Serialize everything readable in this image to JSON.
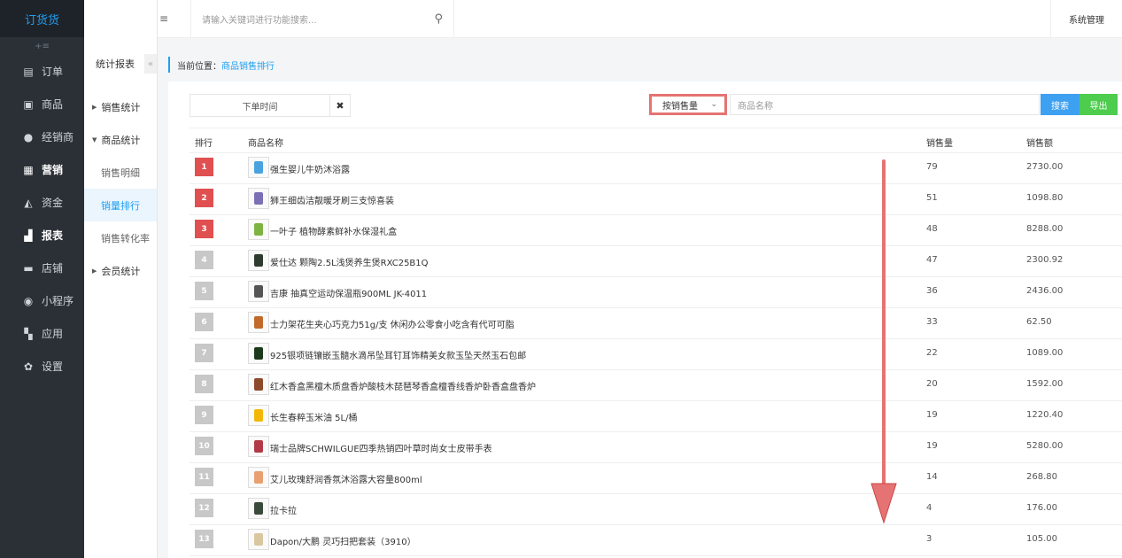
{
  "app": {
    "logo": "订货货",
    "collapse_glyph": "+≡"
  },
  "sidebar": {
    "items": [
      {
        "label": "订单",
        "icon": "document-icon",
        "glyph": "▤",
        "bold": false
      },
      {
        "label": "商品",
        "icon": "image-icon",
        "glyph": "▣",
        "bold": false
      },
      {
        "label": "经销商",
        "icon": "user-icon",
        "glyph": "●",
        "bold": false
      },
      {
        "label": "营销",
        "icon": "gift-icon",
        "glyph": "▦",
        "bold": true
      },
      {
        "label": "资金",
        "icon": "money-bag-icon",
        "glyph": "◭",
        "bold": false
      },
      {
        "label": "报表",
        "icon": "bar-chart-icon",
        "glyph": "▟",
        "bold": true
      },
      {
        "label": "店铺",
        "icon": "store-icon",
        "glyph": "▬",
        "bold": false
      },
      {
        "label": "小程序",
        "icon": "mini-program-icon",
        "glyph": "◉",
        "bold": false
      },
      {
        "label": "应用",
        "icon": "apps-icon",
        "glyph": "▚",
        "bold": false
      },
      {
        "label": "设置",
        "icon": "gear-icon",
        "glyph": "✿",
        "bold": false
      }
    ]
  },
  "topbar": {
    "home_glyph": "⌂",
    "menu_glyph": "≡",
    "search_placeholder": "请输入关键词进行功能搜索...",
    "search_glyph": "⚲",
    "system_label": "系统管理"
  },
  "subnav": {
    "title": "统计报表",
    "fold_glyph": "«",
    "sales_stats": "销售统计",
    "goods_stats": "商品统计",
    "children": [
      "销售明细",
      "销量排行",
      "销售转化率"
    ],
    "member_stats": "会员统计"
  },
  "breadcrumb": {
    "prefix": "当前位置：",
    "current": "商品销售排行"
  },
  "filters": {
    "date_label": "下单时间",
    "clear_glyph": "✖",
    "sort_label": "按销售量",
    "sort_chevron": "⌄",
    "name_placeholder": "商品名称",
    "search_button": "搜索",
    "export_button": "导出"
  },
  "table": {
    "headers": {
      "rank": "排行",
      "name": "商品名称",
      "qty": "销售量",
      "amount": "销售额"
    },
    "rows": [
      {
        "rank": "1",
        "name": "强生婴儿牛奶沐浴露",
        "qty": "79",
        "amount": "2730.00",
        "thumb_color": "#4aa3df"
      },
      {
        "rank": "2",
        "name": "狮王细齿洁靓暖牙刷三支惊喜装",
        "qty": "51",
        "amount": "1098.80",
        "thumb_color": "#7b6fb5"
      },
      {
        "rank": "3",
        "name": "一叶子 植物酵素鲜补水保湿礼盒",
        "qty": "48",
        "amount": "8288.00",
        "thumb_color": "#7cb342"
      },
      {
        "rank": "4",
        "name": "爱仕达 颗陶2.5L浅煲养生煲RXC25B1Q",
        "qty": "47",
        "amount": "2300.92",
        "thumb_color": "#2e3b2e"
      },
      {
        "rank": "5",
        "name": "吉康 抽真空运动保温瓶900ML JK-4011",
        "qty": "36",
        "amount": "2436.00",
        "thumb_color": "#555555"
      },
      {
        "rank": "6",
        "name": "士力架花生夹心巧克力51g/支 休闲办公零食小吃含有代可可脂",
        "qty": "33",
        "amount": "62.50",
        "thumb_color": "#c0692a"
      },
      {
        "rank": "7",
        "name": "925银项链镶嵌玉髓水滴吊坠耳钉耳饰精美女款玉坠天然玉石包邮",
        "qty": "22",
        "amount": "1089.00",
        "thumb_color": "#1b3a1b"
      },
      {
        "rank": "8",
        "name": "红木香盒黑檀木质盘香炉酸枝木琵琶琴香盒檀香线香炉卧香盒盘香炉",
        "qty": "20",
        "amount": "1592.00",
        "thumb_color": "#8d4a2b"
      },
      {
        "rank": "9",
        "name": "长生春粹玉米油 5L/桶",
        "qty": "19",
        "amount": "1220.40",
        "thumb_color": "#f2b705"
      },
      {
        "rank": "10",
        "name": "瑞士品牌SCHWILGUE四季热销四叶草时尚女士皮带手表",
        "qty": "19",
        "amount": "5280.00",
        "thumb_color": "#b23a48"
      },
      {
        "rank": "11",
        "name": "艾儿玫瑰舒润香氛沐浴露大容量800ml",
        "qty": "14",
        "amount": "268.80",
        "thumb_color": "#e8a070"
      },
      {
        "rank": "12",
        "name": "拉卡拉",
        "qty": "4",
        "amount": "176.00",
        "thumb_color": "#3a4a3a"
      },
      {
        "rank": "13",
        "name": "Dapon/大鹏 灵巧扫把套装（3910）",
        "qty": "3",
        "amount": "105.00",
        "thumb_color": "#d9c7a0"
      }
    ]
  },
  "colors": {
    "accent": "#1e9ff2",
    "rank_top": "#e05050",
    "rank_other": "#c8c8c8",
    "annotation": "#e57373"
  }
}
